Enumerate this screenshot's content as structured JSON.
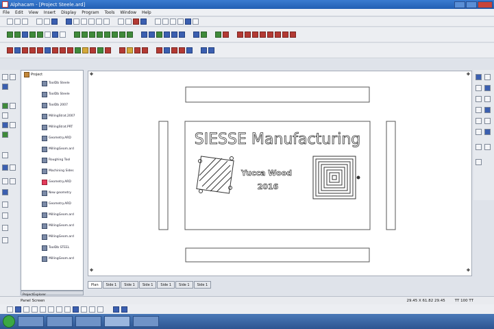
{
  "window": {
    "title": "Alphacam - [Project Steele.ard]"
  },
  "menu": [
    "File",
    "Edit",
    "View",
    "Insert",
    "Display",
    "Program",
    "Tools",
    "Window",
    "Help"
  ],
  "tree": {
    "root_label": "Project",
    "items": [
      {
        "label": "ToolDb Steele"
      },
      {
        "label": "ToolDb Steele"
      },
      {
        "label": "ToolDb 2007"
      },
      {
        "label": "MillingStrat.2007"
      },
      {
        "label": "MillingStrat.PRT"
      },
      {
        "label": "Geometry.ARD"
      },
      {
        "label": "MillingGeom.ard"
      },
      {
        "label": "Roughing Tool"
      },
      {
        "label": "Machining Sides"
      },
      {
        "label": "Geometry.ARD",
        "highlight": true
      },
      {
        "label": "New geometry"
      },
      {
        "label": "Geometry.ARD"
      },
      {
        "label": "MillingGeom.ard"
      },
      {
        "label": "MillingGeom.ard"
      },
      {
        "label": "MillingGeom.ard"
      },
      {
        "label": "ToolDb STEEL"
      },
      {
        "label": "MillingGeom.ard"
      }
    ],
    "scroll_label": "ProjectExplorer"
  },
  "canvas": {
    "headline": "SIESSE Manufacturing",
    "subtitle_line1": "Yucca Wood",
    "subtitle_line2": "2016"
  },
  "tabs": [
    "Plan",
    "Side 1",
    "Side 1",
    "Side 1",
    "Side 1",
    "Side 1",
    "Side 1"
  ],
  "status": {
    "left": "Panel Screen",
    "coords": "29.45 X 61.82 29.45",
    "zoom": "TT 100 TT"
  }
}
